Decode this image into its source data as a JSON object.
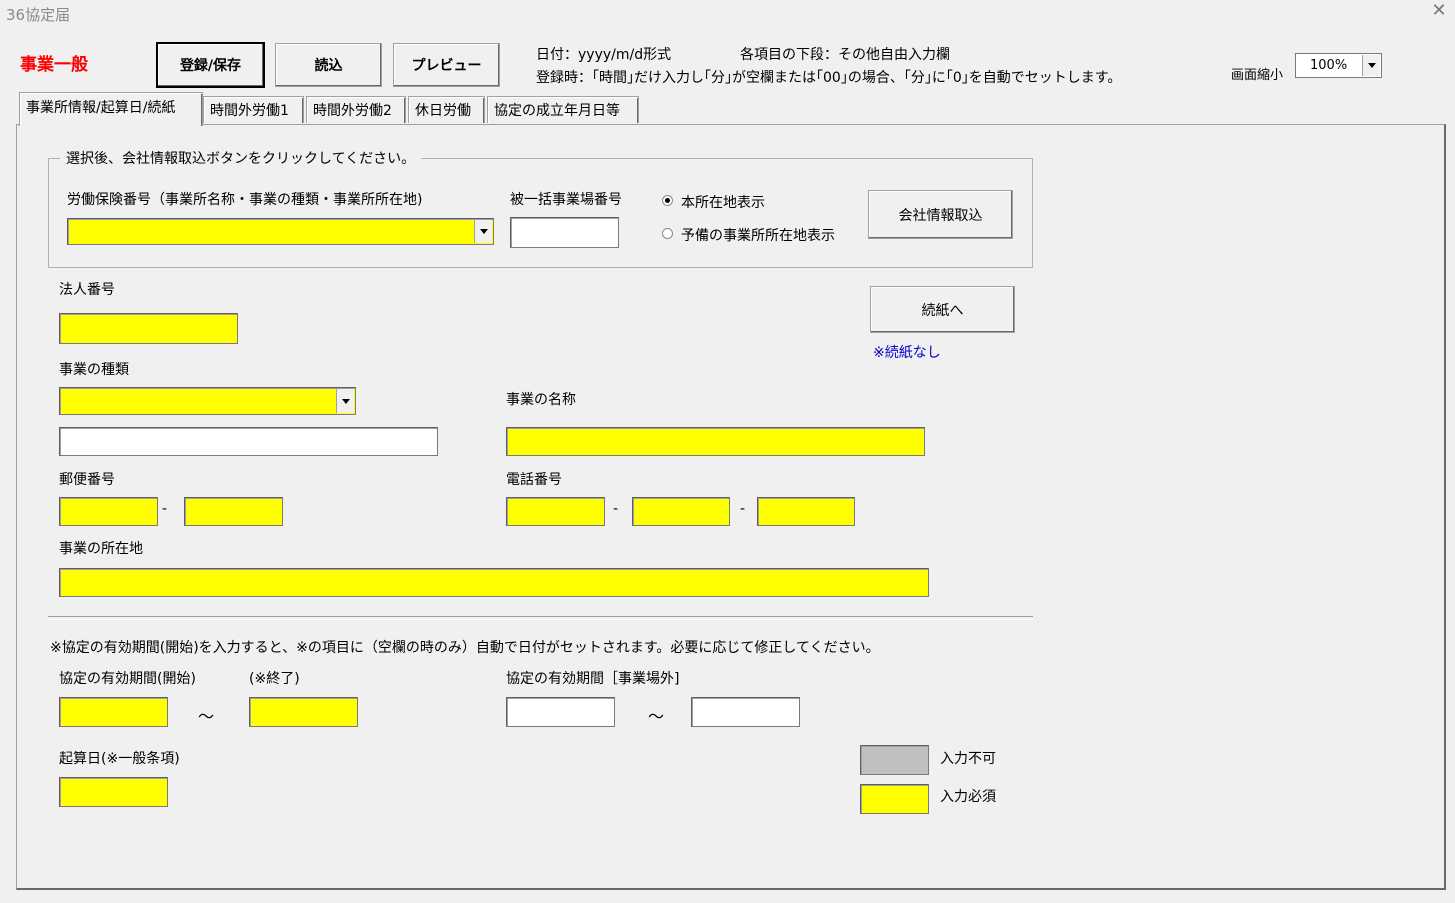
{
  "window": {
    "title": "36協定届",
    "close_icon": "close-icon"
  },
  "header": {
    "form_label": "事業一般",
    "buttons": {
      "save": "登録/保存",
      "load": "読込",
      "preview": "プレビュー"
    },
    "info_line1_a": "日付：yyyy/m/d形式",
    "info_line1_b": "各項目の下段：その他自由入力欄",
    "info_line2": "登録時：｢時間｣だけ入力し｢分｣が空欄または｢00｣の場合、｢分｣に｢0｣を自動でセットします。",
    "zoom_label": "画面縮小",
    "zoom_value": "100%"
  },
  "tabs": [
    {
      "label": "事業所情報/起算日/続紙",
      "active": true
    },
    {
      "label": "時間外労働1",
      "active": false
    },
    {
      "label": "時間外労働2",
      "active": false
    },
    {
      "label": "休日労働",
      "active": false
    },
    {
      "label": "協定の成立年月日等",
      "active": false
    }
  ],
  "company_group": {
    "caption": "選択後、会社情報取込ボタンをクリックしてください。",
    "insurance_label": "労働保険番号（事業所名称・事業の種類・事業所所在地)",
    "insurance_value": "",
    "bulk_label": "被一括事業場番号",
    "bulk_value": "",
    "radio_main": "本所在地表示",
    "radio_alt": "予備の事業所所在地表示",
    "import_button": "会社情報取込"
  },
  "fields": {
    "corp_number_label": "法人番号",
    "continuation_button": "続紙へ",
    "continuation_note": "※続紙なし",
    "business_type_label": "事業の種類",
    "business_name_label": "事業の名称",
    "postal_label": "郵便番号",
    "phone_label": "電話番号",
    "dash": "-",
    "address_label": "事業の所在地"
  },
  "period": {
    "note": "※協定の有効期間(開始)を入力すると、※の項目に（空欄の時のみ）自動で日付がセットされます。必要に応じて修正してください。",
    "start_label": "協定の有効期間(開始)",
    "end_label": "(※終了)",
    "tilde": "～",
    "outside_label": "協定の有効期間［事業場外]",
    "reckoning_label": "起算日(※一般条項)"
  },
  "legend": {
    "disabled_label": "入力不可",
    "required_label": "入力必須",
    "colors": {
      "disabled": "#c0c0c0",
      "required": "#ffff00"
    }
  }
}
